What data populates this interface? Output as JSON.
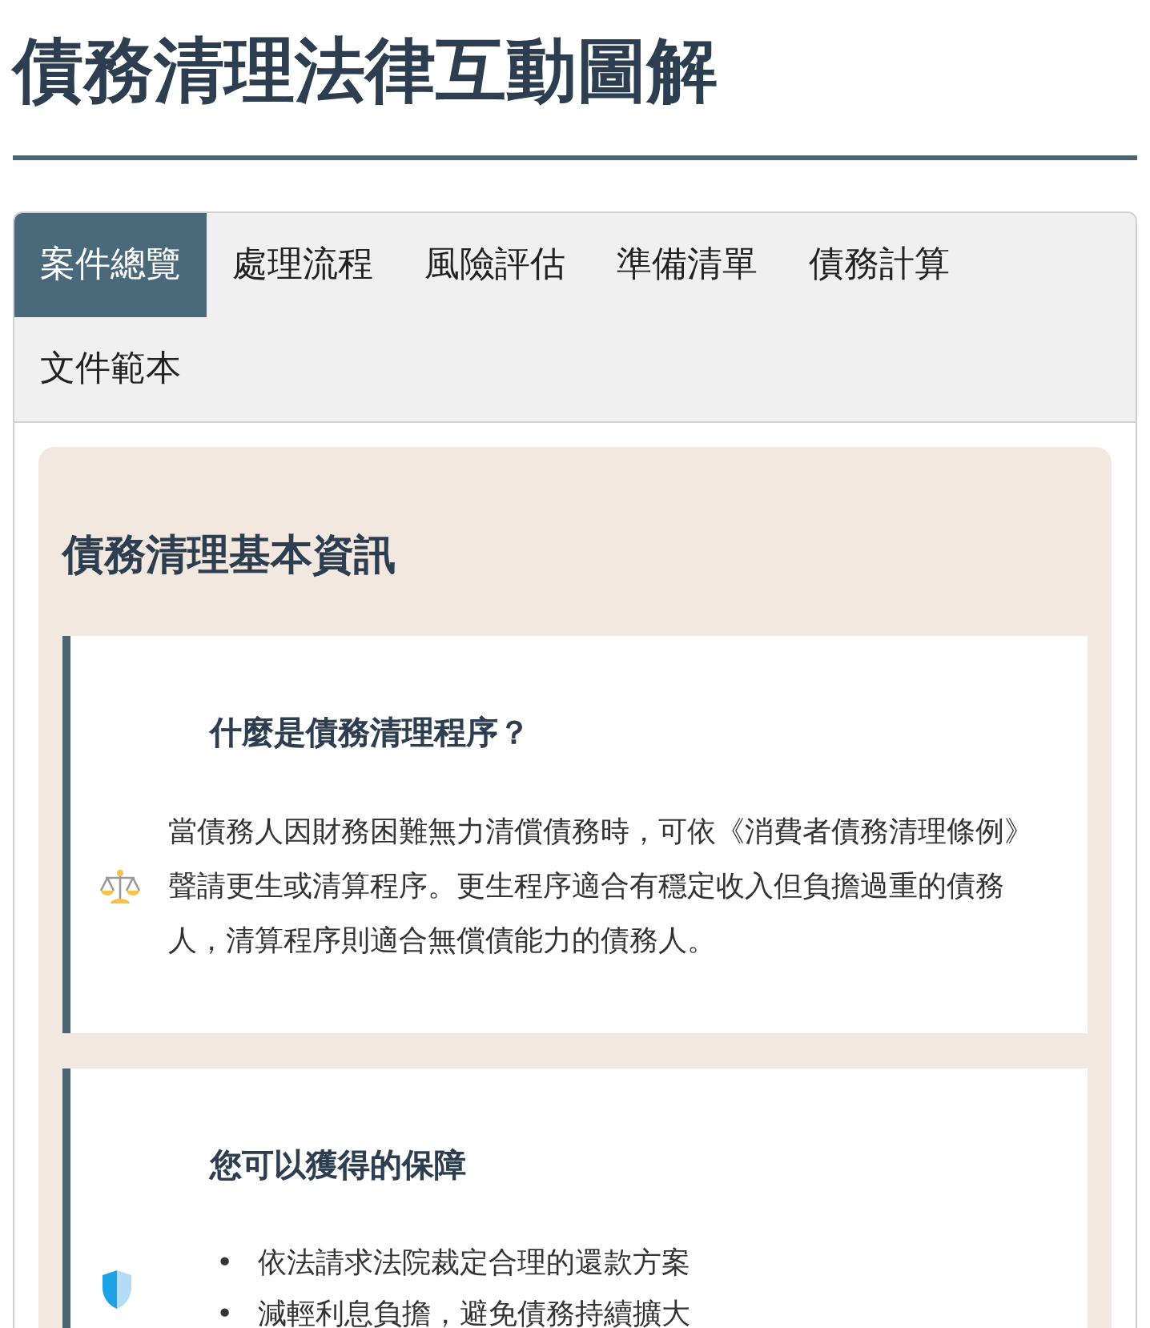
{
  "page": {
    "title": "債務清理法律互動圖解"
  },
  "tabs": [
    {
      "label": "案件總覽",
      "selected": true
    },
    {
      "label": "處理流程",
      "selected": false
    },
    {
      "label": "風險評估",
      "selected": false
    },
    {
      "label": "準備清單",
      "selected": false
    },
    {
      "label": "債務計算",
      "selected": false
    },
    {
      "label": "文件範本",
      "selected": false
    }
  ],
  "section": {
    "title": "債務清理基本資訊",
    "cards": [
      {
        "kind": "paragraph",
        "title": "什麼是債務清理程序？",
        "text": "當債務人因財務困難無力清償債務時，可依《消費者債務清理條例》聲請更生或清算程序。更生程序適合有穩定收入但負擔過重的債務人，清算程序則適合無償債能力的債務人。"
      },
      {
        "kind": "list",
        "title": "您可以獲得的保障",
        "items": [
          {
            "bullet": "•",
            "text": "依法請求法院裁定合理的還款方案"
          },
          {
            "bullet": "•",
            "text": "減輕利息負擔，避免債務持續擴大"
          }
        ]
      }
    ]
  }
}
